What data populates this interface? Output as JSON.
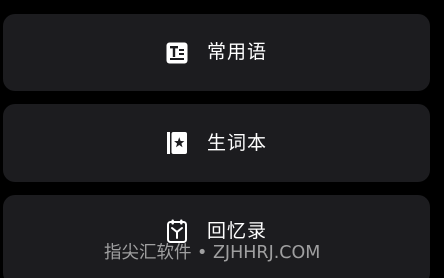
{
  "menu": {
    "items": [
      {
        "label": "常用语",
        "icon": "phrase-card-icon"
      },
      {
        "label": "生词本",
        "icon": "vocabulary-book-icon"
      },
      {
        "label": "回忆录",
        "icon": "memoir-icon"
      }
    ]
  },
  "watermark": {
    "text": "指尖汇软件 • ZJHHRJ.COM"
  },
  "colors": {
    "background": "#000000",
    "card": "#1c1c1f",
    "text": "#ffffff"
  }
}
